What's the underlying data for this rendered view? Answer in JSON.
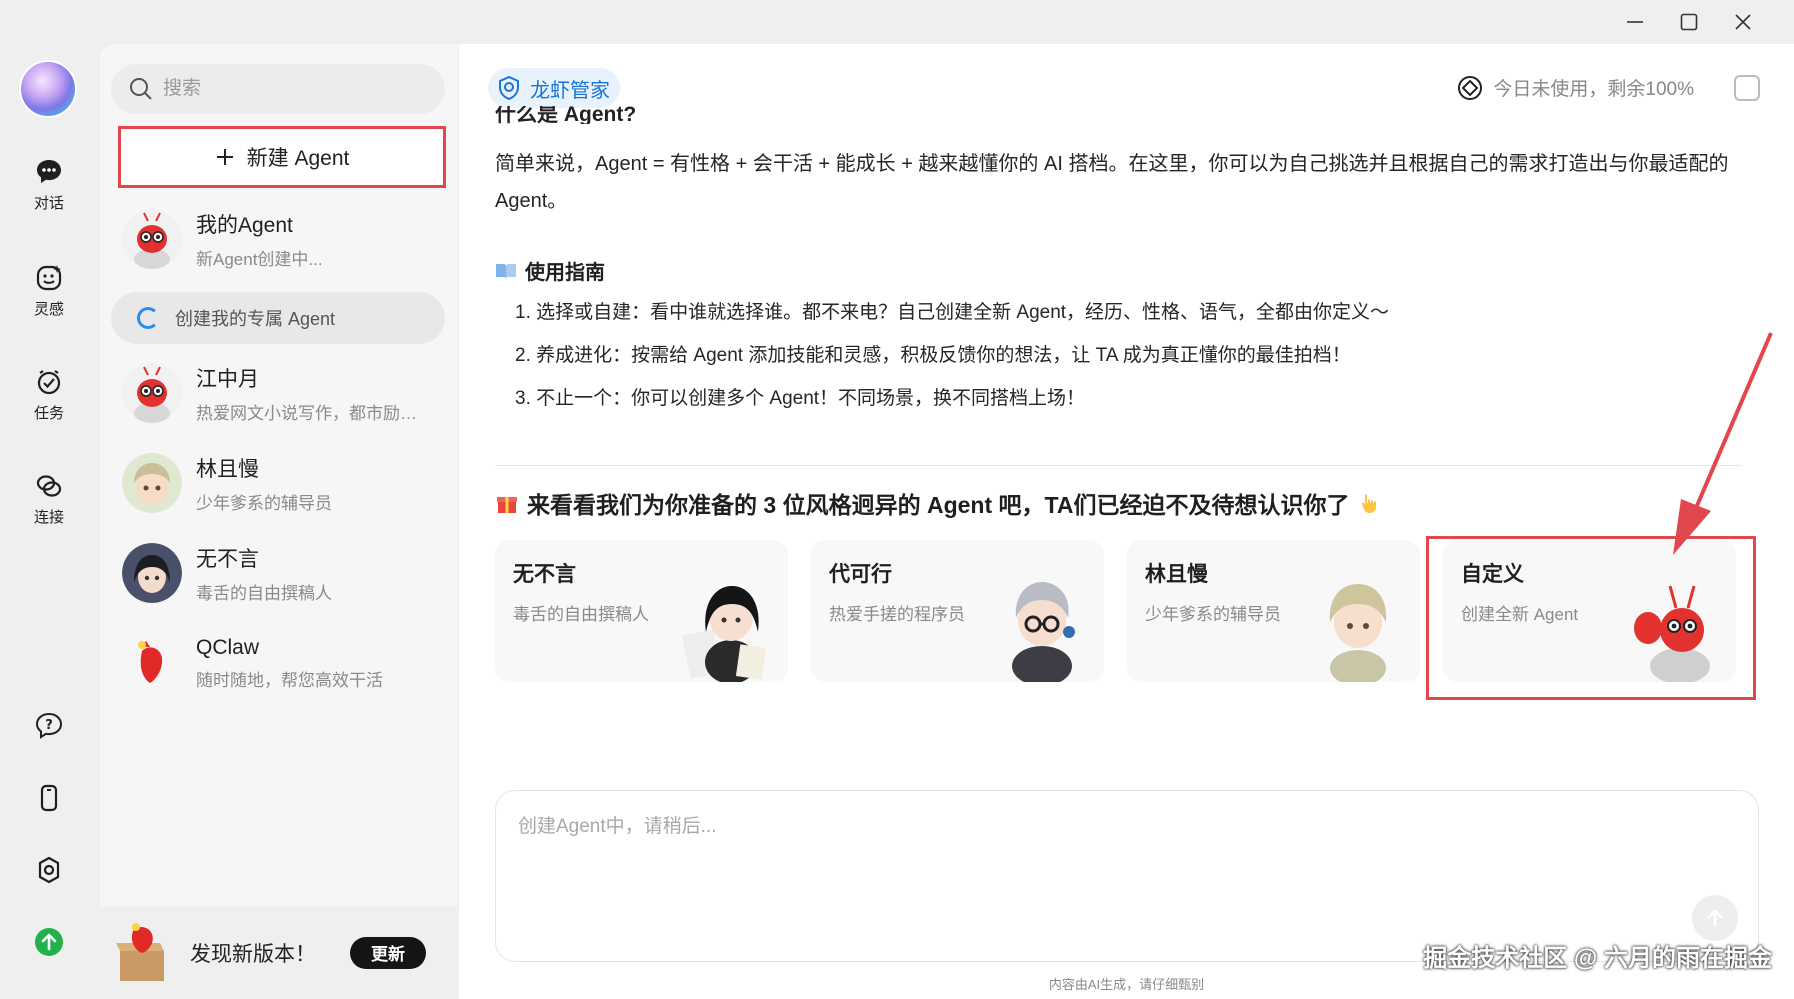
{
  "sidebar": {
    "search_placeholder": "搜索",
    "new_agent_label": "新建 Agent",
    "agents": [
      {
        "name": "我的Agent",
        "desc": "新Agent创建中..."
      },
      {
        "name": "江中月",
        "desc": "热爱网文小说写作，都市励…"
      },
      {
        "name": "林且慢",
        "desc": "少年爹系的辅导员"
      },
      {
        "name": "无不言",
        "desc": "毒舌的自由撰稿人"
      },
      {
        "name": "QClaw",
        "desc": "随时随地，帮您高效干活"
      }
    ],
    "creating_label": "创建我的专属 Agent",
    "update": {
      "message": "发现新版本！",
      "button": "更新"
    }
  },
  "rail": {
    "items": [
      {
        "label": "对话",
        "icon": "chat-icon"
      },
      {
        "label": "灵感",
        "icon": "inspiration-icon"
      },
      {
        "label": "任务",
        "icon": "task-icon"
      },
      {
        "label": "连接",
        "icon": "link-icon"
      }
    ],
    "bottom_icons": [
      "help-icon",
      "phone-icon",
      "settings-icon",
      "upgrade-icon"
    ]
  },
  "header": {
    "pill_label": "龙虾管家",
    "usage_text": "今日未使用，剩余100%"
  },
  "content": {
    "cut_title": "什么是 Agent?",
    "intro": "简单来说，Agent = 有性格 + 会干活 + 能成长 + 越来越懂你的 AI 搭档。在这里，你可以为自己挑选并且根据自己的需求打造出与你最适配的 Agent。",
    "guide_title": "使用指南",
    "guide_items": [
      "1. 选择或自建：看中谁就选择谁。都不来电？自己创建全新 Agent，经历、性格、语气，全都由你定义～",
      "2. 养成进化：按需给 Agent 添加技能和灵感，积极反馈你的想法，让 TA 成为真正懂你的最佳拍档！",
      "3. 不止一个：你可以创建多个 Agent！不同场景，换不同搭档上场！"
    ],
    "cards_title": "来看看我们为你准备的 3 位风格迥异的 Agent 吧，TA们已经迫不及待想认识你了",
    "cards": [
      {
        "name": "无不言",
        "desc": "毒舌的自由撰稿人"
      },
      {
        "name": "代可行",
        "desc": "热爱手搓的程序员"
      },
      {
        "name": "林且慢",
        "desc": "少年爹系的辅导员"
      },
      {
        "name": "自定义",
        "desc": "创建全新 Agent"
      }
    ]
  },
  "composer": {
    "placeholder": "创建Agent中，请稍后..."
  },
  "disclaimer": "内容由AI生成，请仔细甄别",
  "watermark": "掘金技术社区 @ 六月的雨在掘金",
  "colors": {
    "accent": "#1a73d9",
    "highlight": "#e2474d",
    "update_icon": "#22b24c"
  }
}
